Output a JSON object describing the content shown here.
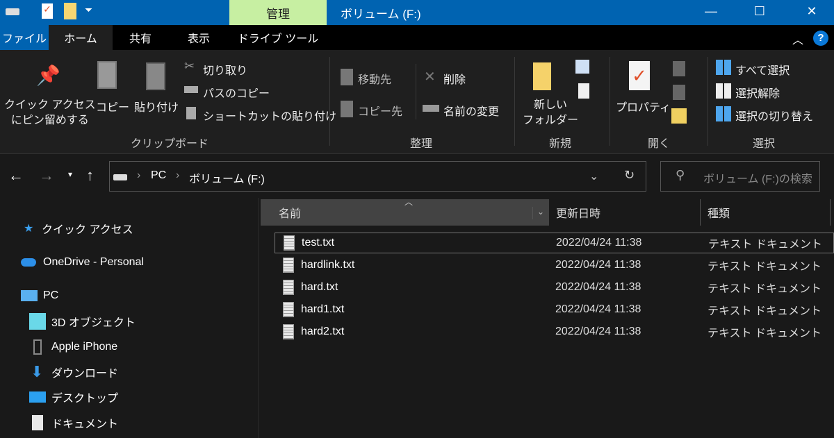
{
  "window": {
    "title": "ボリューム (F:)",
    "context_tab": "管理",
    "minimize": "—",
    "maximize": "☐",
    "close": "✕"
  },
  "tabs": [
    "ファイル",
    "ホーム",
    "共有",
    "表示",
    "ドライブ ツール"
  ],
  "ribbon": {
    "clipboard": {
      "pin": "クイック アクセス",
      "pin2": "にピン留めする",
      "copy": "コピー",
      "paste": "貼り付け",
      "cut": "切り取り",
      "copy_path": "パスのコピー",
      "paste_shortcut": "ショートカットの貼り付け",
      "label": "クリップボード"
    },
    "organize": {
      "move_to": "移動先",
      "copy_to": "コピー先",
      "delete": "削除",
      "rename": "名前の変更",
      "label": "整理"
    },
    "new": {
      "new_folder": "新しい",
      "new_folder2": "フォルダー",
      "label": "新規"
    },
    "open": {
      "properties": "プロパティ",
      "label": "開く"
    },
    "select": {
      "select_all": "すべて選択",
      "select_none": "選択解除",
      "invert": "選択の切り替え",
      "label": "選択"
    }
  },
  "address": {
    "crumbs": [
      "PC",
      "ボリューム (F:)"
    ],
    "search_placeholder": "ボリューム (F:)の検索"
  },
  "nav_pane": [
    "クイック アクセス",
    "OneDrive - Personal",
    "PC",
    "3D オブジェクト",
    "Apple iPhone",
    "ダウンロード",
    "デスクトップ",
    "ドキュメント"
  ],
  "columns": [
    "名前",
    "更新日時",
    "種類"
  ],
  "files": [
    {
      "name": "test.txt",
      "date": "2022/04/24 11:38",
      "type": "テキスト ドキュメント"
    },
    {
      "name": "hardlink.txt",
      "date": "2022/04/24 11:38",
      "type": "テキスト ドキュメント"
    },
    {
      "name": "hard.txt",
      "date": "2022/04/24 11:38",
      "type": "テキスト ドキュメント"
    },
    {
      "name": "hard1.txt",
      "date": "2022/04/24 11:38",
      "type": "テキスト ドキュメント"
    },
    {
      "name": "hard2.txt",
      "date": "2022/04/24 11:38",
      "type": "テキスト ドキュメント"
    }
  ]
}
